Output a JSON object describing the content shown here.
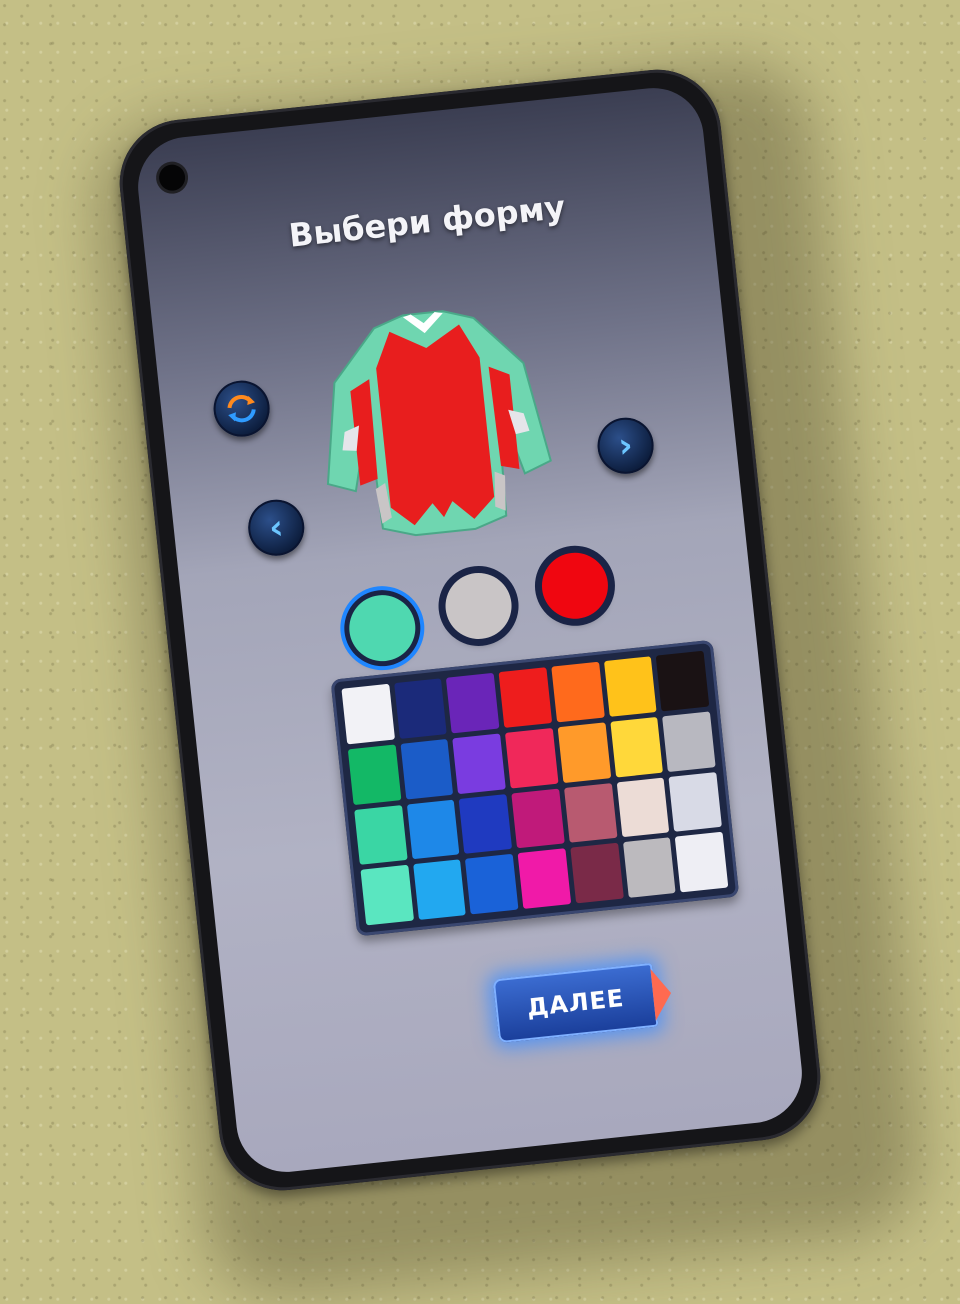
{
  "screen": {
    "title": "Выбери форму",
    "next_button_label": "ДАЛЕЕ",
    "icons": {
      "swap": "swap-arrows-icon",
      "prev": "chevron-left-icon",
      "next": "chevron-right-icon"
    },
    "prev_glyph": "‹",
    "next_glyph": "›"
  },
  "colors": {
    "selected_primary": "#4fd8b0",
    "selected_secondary": "#c9c5c6",
    "selected_tertiary": "#f00610",
    "jersey_body": "#e81e1e",
    "jersey_trim": "#6fd6b0"
  }
}
